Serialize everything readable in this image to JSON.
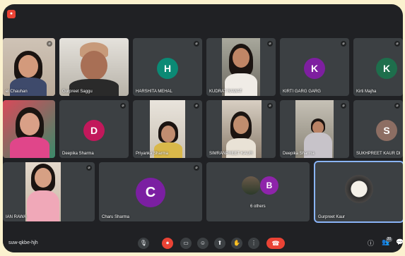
{
  "meeting": {
    "code": "suw-qkbe-hjh"
  },
  "tiles": [
    {
      "name": "el Chauhan"
    },
    {
      "name": "Gurpreet Saggu"
    },
    {
      "name": "HARSHITA MEHAL",
      "initial": "H",
      "color": "#0b8a75"
    },
    {
      "name": "KUDRAT RAWAT"
    },
    {
      "name": "KIRTI GARG GARG",
      "initial": "K",
      "color": "#7e1fa0"
    },
    {
      "name": "Kirti Majha",
      "initial": "K",
      "color": "#1e6e4c"
    },
    {
      "name": ""
    },
    {
      "name": "Deepika Sharma",
      "initial": "D",
      "color": "#c2185b"
    },
    {
      "name": "Priyanka Sharma"
    },
    {
      "name": "SIMRANPREET KAUR"
    },
    {
      "name": "Deepika Sharma"
    },
    {
      "name": "SUKHPREET KAUR DI",
      "initial": "S",
      "color": "#8d6e63"
    },
    {
      "name": "IAN RAWA"
    },
    {
      "name": "Charu Sharma",
      "initial": "C",
      "color": "#7b1fa2"
    },
    {
      "name": "6 others",
      "initial": "B",
      "color": "#8e24aa"
    },
    {
      "name": "Gurpreet Kaur"
    }
  ],
  "controls": {
    "mic": "🎙",
    "camera": "⏺",
    "captions": "▭",
    "emoji": "☺",
    "present": "⬆",
    "hand": "✋",
    "more": "⋮",
    "end": "☎"
  },
  "right_controls": {
    "info": "ⓘ",
    "people": "👥",
    "people_count": "20",
    "chat": "💬",
    "activities": "⌗"
  },
  "colors": {
    "background": "#202124",
    "tile": "#3c4043",
    "accent": "#8ab4f8",
    "danger": "#ea4335"
  }
}
